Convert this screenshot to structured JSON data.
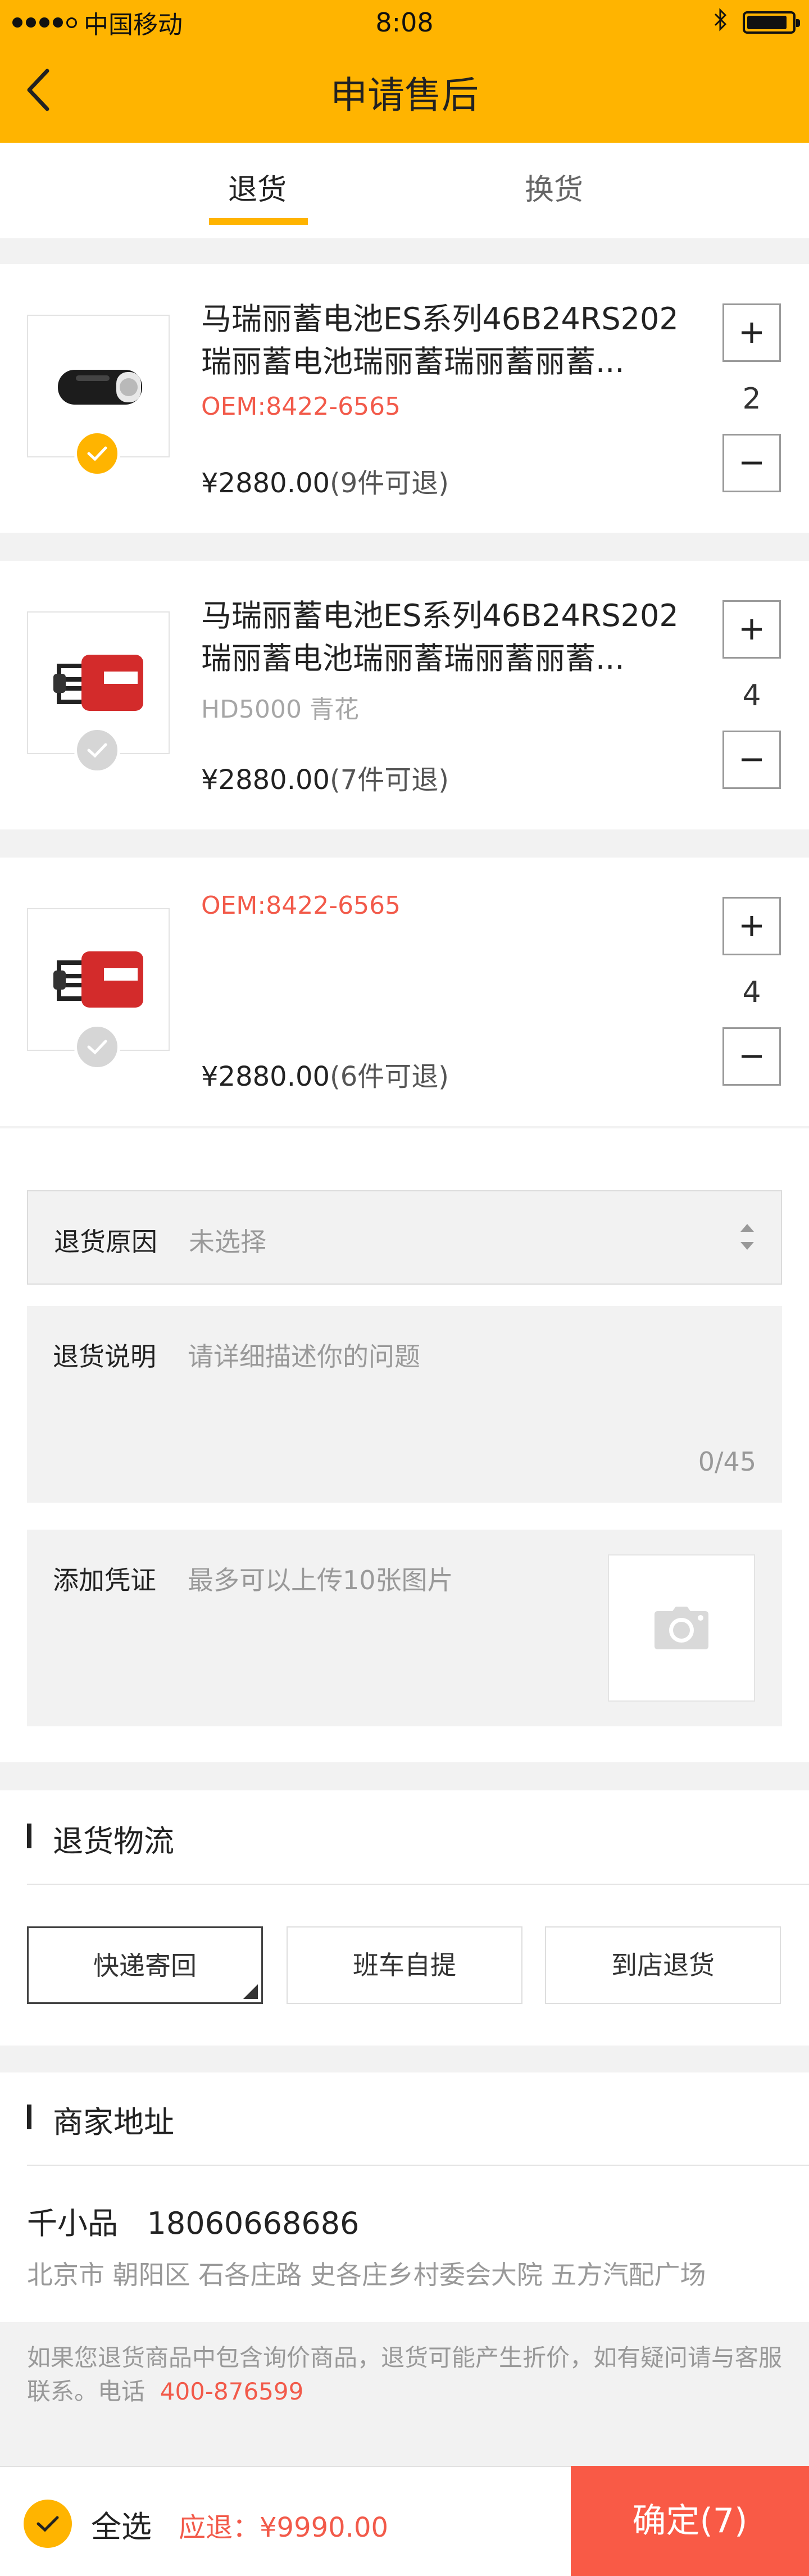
{
  "status_bar": {
    "carrier": "中国移动",
    "time": "8:08",
    "bluetooth_icon": "bluetooth-icon",
    "battery_level": 0.9
  },
  "nav": {
    "title": "申请售后",
    "back_icon": "chevron-left-icon"
  },
  "tabs": [
    {
      "label": "退货",
      "active": true
    },
    {
      "label": "换货",
      "active": false
    }
  ],
  "products": [
    {
      "name_line1": "马瑞丽蓄电池ES系列46B24RS202",
      "name_line2": "瑞丽蓄电池瑞丽蓄瑞丽蓄丽蓄...",
      "sub": "OEM:8422-6565",
      "price": "¥2880.00",
      "note": "(9件可退)",
      "qty": "2",
      "selected": true
    },
    {
      "name_line1": "马瑞丽蓄电池ES系列46B24RS202",
      "name_line2": "瑞丽蓄电池瑞丽蓄瑞丽蓄丽蓄...",
      "sub": "HD5000 青花",
      "price": "¥2880.00",
      "note": "(7件可退)",
      "qty": "4",
      "selected": false
    },
    {
      "name_line1": "",
      "name_line2": "",
      "sub": "OEM:8422-6565",
      "price": "¥2880.00",
      "note": "(6件可退)",
      "qty": "4",
      "selected": false
    }
  ],
  "form": {
    "reason_label": "退货原因",
    "reason_value": "未选择",
    "desc_label": "退货说明",
    "desc_placeholder": "请详细描述你的问题",
    "desc_counter": "0/45",
    "proof_label": "添加凭证",
    "proof_hint": "最多可以上传10张图片"
  },
  "logistics": {
    "title": "退货物流",
    "options": [
      "快递寄回",
      "班车自提",
      "到店退货"
    ],
    "selected_index": 0
  },
  "address": {
    "title": "商家地址",
    "name": "千小品",
    "phone": "18060668686",
    "detail": "北京市 朝阳区 石各庄路 史各庄乡村委会大院 五方汽配广场"
  },
  "notice": {
    "text": "如果您退货商品中包含询价商品，退货可能产生折价，如有疑问请与客服联系。电话",
    "phone": "400-876599"
  },
  "bottom": {
    "select_all": "全选",
    "refund_label": "应退：",
    "refund_amount": "¥9990.00",
    "confirm": "确定(7)"
  },
  "colors": {
    "accent": "#ffb400",
    "danger": "#f95a46",
    "red_text": "#f25a4a"
  }
}
